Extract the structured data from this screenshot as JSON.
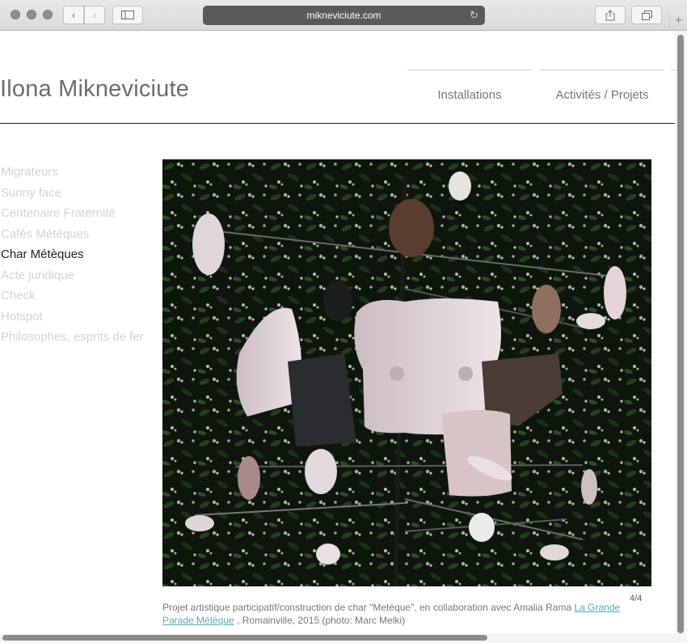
{
  "browser": {
    "url": "mikneviciute.com"
  },
  "site": {
    "title": "Ilona Mikneviciute",
    "nav": [
      {
        "label": "Installations"
      },
      {
        "label": "Activités / Projets"
      }
    ]
  },
  "sidebar": {
    "items": [
      {
        "label": "Migrateurs",
        "active": false
      },
      {
        "label": "Sunny face",
        "active": false
      },
      {
        "label": "Centenaire Fraternité",
        "active": false
      },
      {
        "label": "Cafés Métèques",
        "active": false
      },
      {
        "label": "Char Métèques",
        "active": true
      },
      {
        "label": "Acte juridique",
        "active": false
      },
      {
        "label": "Check",
        "active": false
      },
      {
        "label": "Hotspot",
        "active": false
      },
      {
        "label": "Philosophes, esprits de fer",
        "active": false
      }
    ]
  },
  "gallery": {
    "counter": "4/4",
    "caption_before": "Projet artistique participatif/construction de char \"Metèque\", en collaboration avec Amalia Rama ",
    "caption_link": "La Grande Parade Métèque",
    "caption_after": " , Romainville, 2015 (photo: Marc Melki)"
  },
  "colors": {
    "active_item": "#222222",
    "inactive_item": "#d2d2d2",
    "link": "#5aa8b3"
  }
}
